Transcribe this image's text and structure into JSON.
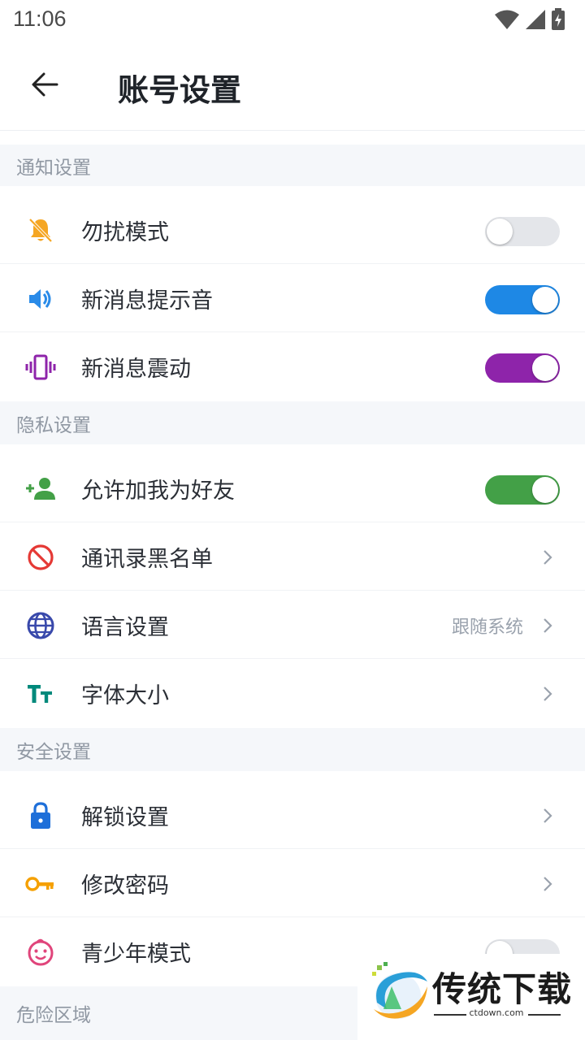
{
  "status_bar": {
    "time": "11:06"
  },
  "app_bar": {
    "title": "账号设置"
  },
  "sections": {
    "notify": {
      "title": "通知设置",
      "dnd": "勿扰模式",
      "sound": "新消息提示音",
      "vibrate": "新消息震动"
    },
    "privacy": {
      "title": "隐私设置",
      "allow_friend": "允许加我为好友",
      "blacklist": "通讯录黑名单",
      "language": "语言设置",
      "language_value": "跟随系统",
      "font_size": "字体大小"
    },
    "security": {
      "title": "安全设置",
      "unlock": "解锁设置",
      "password": "修改密码",
      "teen": "青少年模式"
    },
    "danger": {
      "title": "危险区域"
    }
  },
  "toggles": {
    "dnd": false,
    "sound": true,
    "vibrate": true,
    "allow_friend": true
  },
  "colors": {
    "dnd_icon": "#f5a623",
    "sound_icon": "#2a8be8",
    "vibrate_icon": "#8e24aa",
    "friend_icon": "#43a047",
    "blacklist_icon": "#e53935",
    "language_icon": "#3949ab",
    "font_icon": "#00897b",
    "lock_icon": "#1e6fd9",
    "key_icon": "#f5a000",
    "teen_icon": "#e0457b",
    "toggle_sound": "#1e88e5",
    "toggle_vibrate": "#8e24aa",
    "toggle_friend": "#43a047"
  },
  "icons": {
    "dnd": "bell-off-icon",
    "sound": "speaker-icon",
    "vibrate": "vibration-icon",
    "friend": "person-add-icon",
    "blacklist": "block-icon",
    "language": "globe-icon",
    "font": "text-size-icon",
    "lock": "lock-icon",
    "key": "key-icon",
    "teen": "child-face-icon"
  },
  "watermark": {
    "brand": "传统下载",
    "domain": "ctdown.com"
  }
}
